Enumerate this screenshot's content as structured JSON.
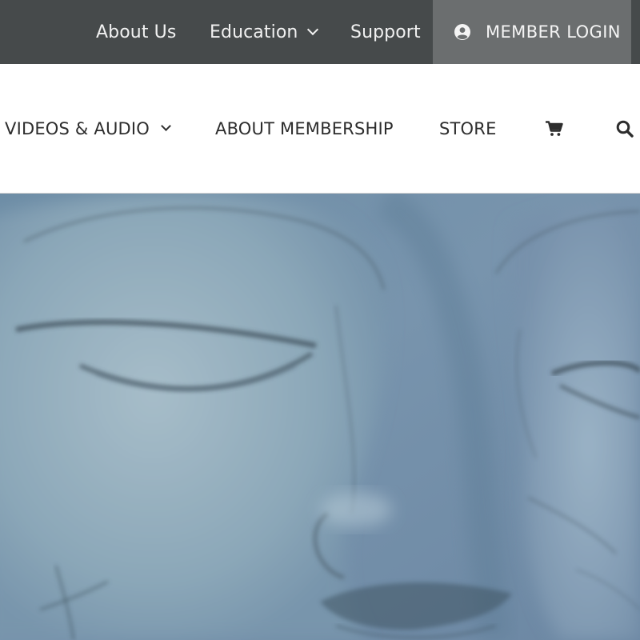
{
  "topbar": {
    "items": [
      {
        "label": "About Us"
      },
      {
        "label": "Education",
        "has_dropdown": true
      },
      {
        "label": "Support"
      }
    ],
    "member_login": {
      "label": "MEMBER LOGIN",
      "icon": "user-circle-icon"
    }
  },
  "mainnav": {
    "items": [
      {
        "label": "VIDEOS & AUDIO",
        "has_dropdown": true
      },
      {
        "label": "ABOUT MEMBERSHIP"
      },
      {
        "label": "STORE"
      }
    ],
    "icons": [
      "cart-icon",
      "search-icon"
    ]
  },
  "hero": {
    "image": "sketch-buddha-faces",
    "tint": "#6f8fa8"
  },
  "colors": {
    "topbar_bg": "#464a4b",
    "member_login_bg": "#6b6e6f",
    "nav_text": "#2d2d2d"
  }
}
